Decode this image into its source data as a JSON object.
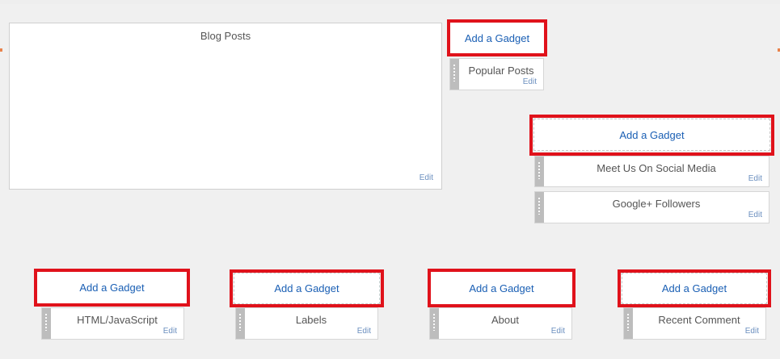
{
  "main": {
    "blog_posts": {
      "title": "Blog Posts",
      "edit_label": "Edit"
    }
  },
  "add_gadget_label": "Add a Gadget",
  "edit_label": "Edit",
  "sidebar_top": {
    "gadgets": [
      {
        "title": "Popular Posts"
      }
    ]
  },
  "sidebar_right": {
    "gadgets": [
      {
        "title": "Meet Us On Social Media"
      },
      {
        "title": "Google+ Followers"
      }
    ]
  },
  "footer_columns": [
    {
      "gadget": "HTML/JavaScript"
    },
    {
      "gadget": "Labels"
    },
    {
      "gadget": "About"
    },
    {
      "gadget": "Recent Comment"
    }
  ],
  "colors": {
    "highlight": "#e0121b",
    "link": "#1a5fb4",
    "edit": "#6b8fbf",
    "handle": "#bdbdbd"
  }
}
